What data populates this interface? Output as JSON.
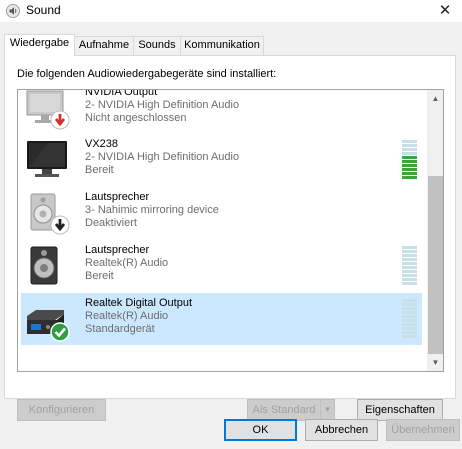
{
  "window": {
    "title": "Sound",
    "close_glyph": "✕"
  },
  "tabs": [
    {
      "label": "Wiedergabe",
      "active": true
    },
    {
      "label": "Aufnahme",
      "active": false
    },
    {
      "label": "Sounds",
      "active": false
    },
    {
      "label": "Kommunikation",
      "active": false
    }
  ],
  "header": {
    "text": "Die folgenden Audiowiedergabegeräte sind installiert:"
  },
  "devices": [
    {
      "name": "NVIDIA Output",
      "detail": "2- NVIDIA High Definition Audio",
      "status": "Nicht angeschlossen",
      "icon": "monitor-disconnected-icon",
      "selected": false,
      "level_visible": false,
      "level_active_bars": 0
    },
    {
      "name": "VX238",
      "detail": "2- NVIDIA High Definition Audio",
      "status": "Bereit",
      "icon": "monitor-icon",
      "selected": false,
      "level_visible": true,
      "level_active_bars": 6
    },
    {
      "name": "Lautsprecher",
      "detail": "3- Nahimic mirroring device",
      "status": "Deaktiviert",
      "icon": "speaker-disabled-icon",
      "selected": false,
      "level_visible": false,
      "level_active_bars": 0
    },
    {
      "name": "Lautsprecher",
      "detail": "Realtek(R) Audio",
      "status": "Bereit",
      "icon": "speaker-icon",
      "selected": false,
      "level_visible": true,
      "level_active_bars": 0
    },
    {
      "name": "Realtek Digital Output",
      "detail": "Realtek(R) Audio",
      "status": "Standardgerät",
      "icon": "digital-output-default-icon",
      "selected": true,
      "level_visible": true,
      "level_active_bars": 0
    }
  ],
  "scrollbar": {
    "up_glyph": "▲",
    "down_glyph": "▼"
  },
  "buttons": {
    "configure": "Konfigurieren",
    "set_default": "Als Standard",
    "set_default_arrow": "▼",
    "properties": "Eigenschaften",
    "ok": "OK",
    "cancel": "Abbrechen",
    "apply": "Übernehmen"
  },
  "colors": {
    "accent": "#0078d7",
    "selection": "#cce8ff",
    "level_on": "#3da33d",
    "level_off": "#c9dfe8"
  }
}
